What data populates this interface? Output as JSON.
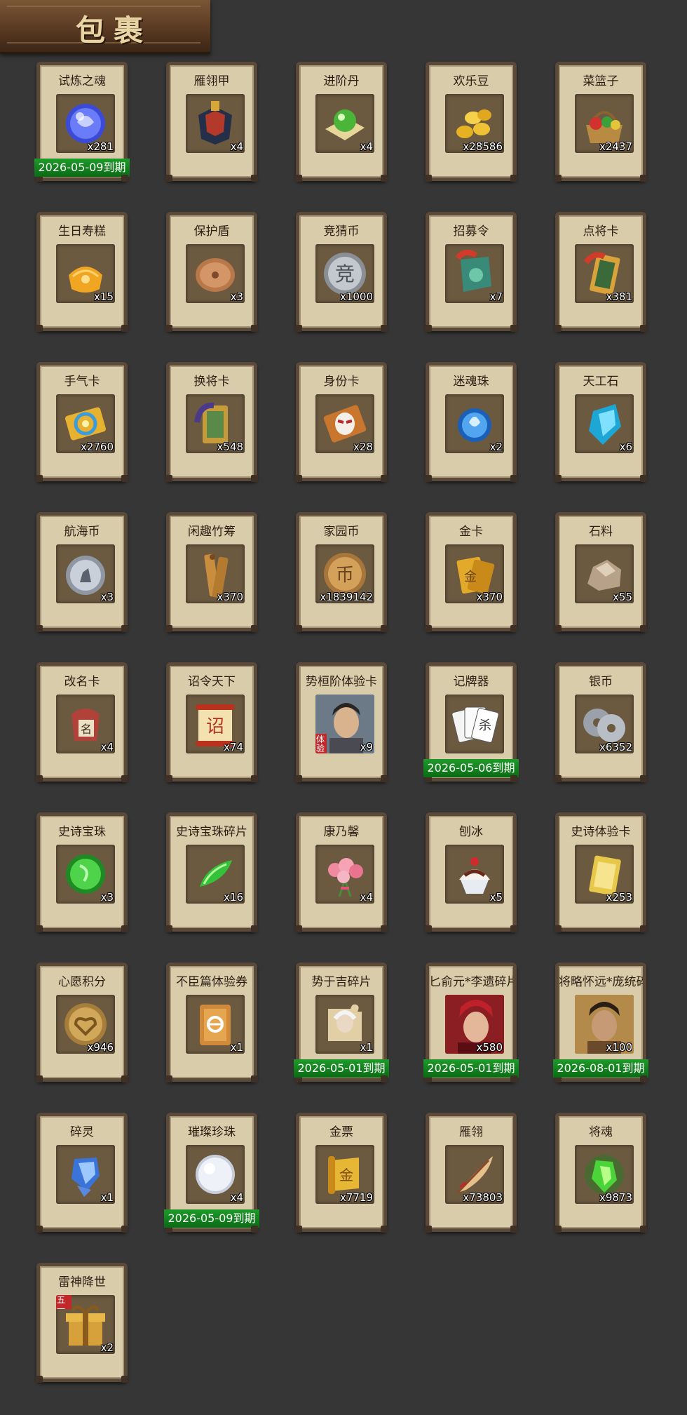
{
  "title": "包裹",
  "items": [
    {
      "name": "试炼之魂",
      "count": "x281",
      "icon": "blue-orb-icon",
      "expiry": "2026-05-09到期"
    },
    {
      "name": "雁翎甲",
      "count": "x4",
      "icon": "armor-icon"
    },
    {
      "name": "进阶丹",
      "count": "x4",
      "icon": "green-pill-icon"
    },
    {
      "name": "欢乐豆",
      "count": "x28586",
      "icon": "gold-beans-icon"
    },
    {
      "name": "菜篮子",
      "count": "x2437",
      "icon": "basket-icon"
    },
    {
      "name": "生日寿糕",
      "count": "x15",
      "icon": "cake-icon"
    },
    {
      "name": "保护盾",
      "count": "x3",
      "icon": "shield-icon"
    },
    {
      "name": "竞猜币",
      "count": "x1000",
      "icon": "silver-coin-icon"
    },
    {
      "name": "招募令",
      "count": "x7",
      "icon": "jade-token-icon"
    },
    {
      "name": "点将卡",
      "count": "x381",
      "icon": "general-card-icon"
    },
    {
      "name": "手气卡",
      "count": "x2760",
      "icon": "luck-card-icon"
    },
    {
      "name": "换将卡",
      "count": "x548",
      "icon": "swap-card-icon"
    },
    {
      "name": "身份卡",
      "count": "x28",
      "icon": "mask-card-icon"
    },
    {
      "name": "迷魂珠",
      "count": "x2",
      "icon": "blue-flame-orb-icon"
    },
    {
      "name": "天工石",
      "count": "x6",
      "icon": "blue-crystal-icon"
    },
    {
      "name": "航海币",
      "count": "x3",
      "icon": "sail-coin-icon"
    },
    {
      "name": "闲趣竹筹",
      "count": "x370",
      "icon": "bamboo-tally-icon"
    },
    {
      "name": "家园币",
      "count": "x1839142",
      "icon": "home-coin-icon"
    },
    {
      "name": "金卡",
      "count": "x370",
      "icon": "gold-card-icon"
    },
    {
      "name": "石料",
      "count": "x55",
      "icon": "stone-icon"
    },
    {
      "name": "改名卡",
      "count": "x4",
      "icon": "rename-card-icon"
    },
    {
      "name": "诏令天下",
      "count": "x74",
      "icon": "edict-scroll-icon"
    },
    {
      "name": "势桓阶体验卡",
      "count": "x9",
      "icon": "hero-portrait-icon",
      "badge": "体验"
    },
    {
      "name": "记牌器",
      "count": "",
      "icon": "playing-cards-icon",
      "expiry": "2026-05-06到期"
    },
    {
      "name": "银币",
      "count": "x6352",
      "icon": "silver-coins-icon"
    },
    {
      "name": "史诗宝珠",
      "count": "x3",
      "icon": "green-orb-icon"
    },
    {
      "name": "史诗宝珠碎片",
      "count": "x16",
      "icon": "green-shard-icon"
    },
    {
      "name": "康乃馨",
      "count": "x4",
      "icon": "carnation-icon"
    },
    {
      "name": "刨冰",
      "count": "x5",
      "icon": "shaved-ice-icon"
    },
    {
      "name": "史诗体验卡",
      "count": "x253",
      "icon": "gold-ticket-icon"
    },
    {
      "name": "心愿积分",
      "count": "x946",
      "icon": "heart-coin-icon"
    },
    {
      "name": "不臣篇体验券",
      "count": "x1",
      "icon": "coupon-icon"
    },
    {
      "name": "势于吉碎片",
      "count": "x1",
      "icon": "puzzle-portrait-icon",
      "expiry": "2026-05-01到期"
    },
    {
      "name": "匕俞元*李遗碎片",
      "count": "x580",
      "icon": "red-hero-portrait-icon",
      "expiry": "2026-05-01到期"
    },
    {
      "name": "将略怀远*庞统碎片",
      "count": "x100",
      "icon": "hero-portrait-2-icon",
      "expiry": "2026-08-01到期"
    },
    {
      "name": "碎灵",
      "count": "x1",
      "icon": "blue-shard-icon"
    },
    {
      "name": "璀璨珍珠",
      "count": "x4",
      "icon": "pearl-icon",
      "expiry": "2026-05-09到期"
    },
    {
      "name": "金票",
      "count": "x7719",
      "icon": "gold-ticket-scroll-icon"
    },
    {
      "name": "雁翎",
      "count": "x73803",
      "icon": "feather-icon"
    },
    {
      "name": "将魂",
      "count": "x9873",
      "icon": "green-soul-crystal-icon"
    },
    {
      "name": "雷神降世",
      "count": "x2",
      "icon": "gift-box-icon",
      "badge": "五一"
    }
  ],
  "colors": {
    "background": "#363636",
    "card": "#d9ccaa",
    "expiry_bar": "#138a20"
  }
}
